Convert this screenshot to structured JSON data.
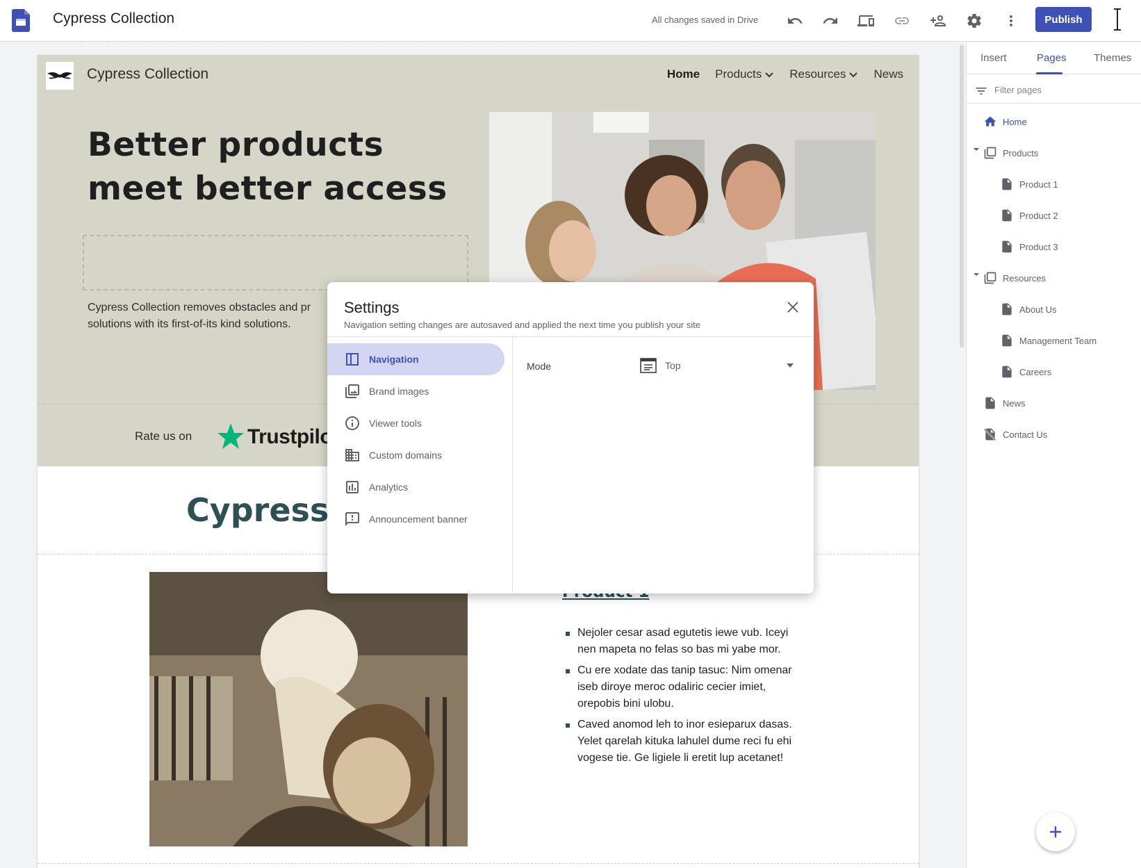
{
  "app": {
    "title": "Cypress Collection",
    "save_status": "All changes saved in Drive",
    "publish_label": "Publish",
    "toolbar_icons": [
      "undo-icon",
      "redo-icon",
      "preview-devices-icon",
      "link-icon",
      "share-person-icon",
      "settings-gear-icon",
      "more-vert-icon"
    ]
  },
  "site": {
    "name": "Cypress Collection",
    "nav": [
      "Home",
      "Products",
      "Resources",
      "News"
    ],
    "hero_title_line1": "Better products",
    "hero_title_line2": "meet better access",
    "hero_desc_line1": "Cypress Collection removes obstacles and pr",
    "hero_desc_line2": "solutions with its first-of-its kind solutions.",
    "rate_label": "Rate us on",
    "trustpilot": "Trustpilo",
    "section_title": "Cypress P",
    "product_title": "Product 1",
    "bullets": [
      "Nejoler cesar asad egutetis iewe vub. Iceyi nen mapeta no felas so bas mi yabe mor.",
      "Cu ere xodate das tanip tasuc: Nim omenar iseb diroye meroc odaliric cecier imiet, orepobis bini ulobu.",
      "Caved anomod leh to inor esieparux dasas. Yelet qarelah kituka lahulel dume reci fu ehi vogese tie. Ge ligiele li eretit lup acetanet!"
    ]
  },
  "panel": {
    "tabs": [
      "Insert",
      "Pages",
      "Themes"
    ],
    "active_tab": "Pages",
    "filter_placeholder": "Filter pages",
    "pages": {
      "home": "Home",
      "products": "Products",
      "product1": "Product 1",
      "product2": "Product 2",
      "product3": "Product 3",
      "resources": "Resources",
      "about": "About Us",
      "management": "Management Team",
      "careers": "Careers",
      "news": "News",
      "contact": "Contact Us"
    }
  },
  "dialog": {
    "title": "Settings",
    "subtitle": "Navigation setting changes are autosaved and applied the next time you publish your site",
    "menu": [
      "Navigation",
      "Brand images",
      "Viewer tools",
      "Custom domains",
      "Analytics",
      "Announcement banner"
    ],
    "active_menu": "Navigation",
    "mode_label": "Mode",
    "mode_value": "Top"
  },
  "colors": {
    "accent": "#3f51b5",
    "hero_bg": "#d6d6c8",
    "heading_teal": "#2e5055",
    "trustpilot_green": "#00b67a"
  }
}
